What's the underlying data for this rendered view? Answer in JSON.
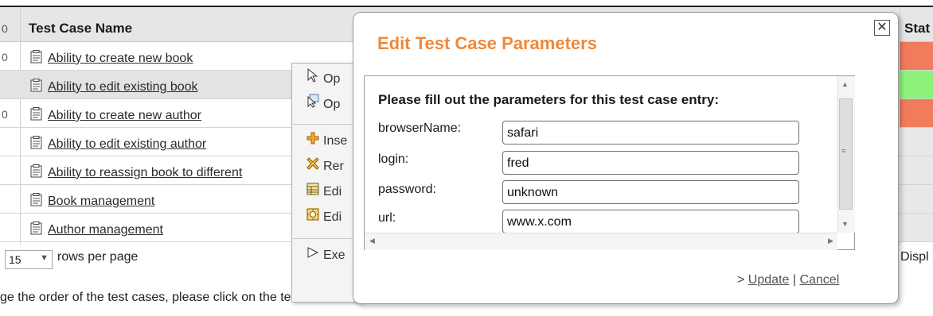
{
  "table": {
    "header": {
      "name_column": "Test Case Name",
      "status_column": "Stat"
    },
    "rows": [
      {
        "name": "Ability to create new book",
        "lead": "0",
        "status_color": "#f07c5c"
      },
      {
        "name": "Ability to edit existing book",
        "lead": "",
        "status_color": "#8ef27a",
        "selected": true
      },
      {
        "name": "Ability to create new author",
        "lead": "0",
        "status_color": "#f07c5c"
      },
      {
        "name": "Ability to edit existing author",
        "lead": "",
        "status_color": "#e8e8e8"
      },
      {
        "name": "Ability to reassign book to different",
        "lead": "",
        "status_color": "#e8e8e8"
      },
      {
        "name": "Book management",
        "lead": "",
        "status_color": "#e8e8e8"
      },
      {
        "name": "Author management",
        "lead": "",
        "status_color": "#e8e8e8"
      }
    ],
    "rows_per_page_value": "15",
    "rows_per_page_label": "rows per page",
    "display_text": "Displ",
    "footnote": "ge the order of the test cases, please click on the te"
  },
  "context_menu": {
    "items": [
      {
        "label": "Op",
        "icon": "pointer-icon"
      },
      {
        "label": "Op",
        "icon": "pointer-window-icon"
      },
      {
        "label": "Inse",
        "icon": "insert-icon"
      },
      {
        "label": "Rer",
        "icon": "remove-icon"
      },
      {
        "label": "Edi",
        "icon": "edit-grid-icon"
      },
      {
        "label": "Edi",
        "icon": "edit-gear-icon"
      },
      {
        "label": "Exe",
        "icon": "execute-icon"
      }
    ]
  },
  "dialog": {
    "title": "Edit Test Case Parameters",
    "prompt": "Please fill out the parameters for this test case entry:",
    "fields": [
      {
        "label": "browserName:",
        "value": "safari"
      },
      {
        "label": "login:",
        "value": "fred"
      },
      {
        "label": "password:",
        "value": "unknown"
      },
      {
        "label": "url:",
        "value": "www.x.com"
      }
    ],
    "actions_prefix": "> ",
    "update_label": "Update",
    "separator": " | ",
    "cancel_label": "Cancel",
    "accent_color": "#f0883a"
  }
}
